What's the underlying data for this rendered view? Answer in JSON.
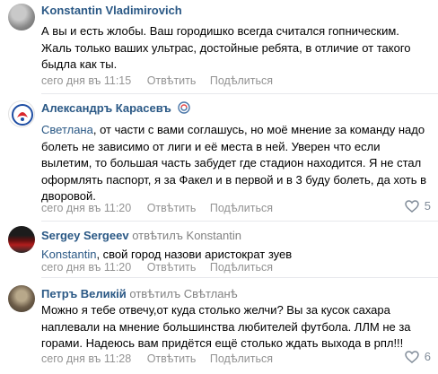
{
  "comments": [
    {
      "author": "Konstantin Vladimirovich",
      "reply_word": "",
      "reply_target": "",
      "mention": "",
      "lines": [
        "А вы и есть жлобы. Ваш городишко всегда считался гопническим.",
        "Жаль только ваших ультрас, достойные ребята, в отличие от такого",
        "быдла как ты."
      ],
      "date": "сего дня въ 11:15",
      "reply_label": "Отвѣтить",
      "share_label": "Подѣлиться",
      "likes": ""
    },
    {
      "author": "Александръ Карасевъ",
      "reply_word": "",
      "reply_target": "",
      "mention": "Светлана",
      "lines": [
        ", от части с вами соглашусь, но моё мнение за команду надо",
        "болеть не зависимо от лиги и её места в ней. Уверен что если",
        "вылетим, то большая часть забудет где стадион находится. Я не стал",
        "оформлять паспорт, я за Факел и в первой и в 3 буду болеть, да хоть в",
        "дворовой."
      ],
      "date": "сего дня въ 11:20",
      "reply_label": "Отвѣтить",
      "share_label": "Подѣлиться",
      "likes": "5"
    },
    {
      "author": "Sergey Sergeev",
      "reply_word": "отвѣтилъ",
      "reply_target": "Konstantin",
      "mention": "Konstantin",
      "lines": [
        ", свой город назови аристократ зуев"
      ],
      "date": "сего дня въ 11:20",
      "reply_label": "Отвѣтить",
      "share_label": "Подѣлиться",
      "likes": ""
    },
    {
      "author": "Петръ Великій",
      "reply_word": "отвѣтилъ",
      "reply_target": "Свѣтланѣ",
      "mention": "",
      "lines": [
        "Можно я тебе отвечу,от куда столько желчи? Вы за кусок сахара",
        "наплевали на мнение большинства любителей футбола. ЛЛМ не за",
        "горами. Надеюсь вам придётся ещё столько ждать выхода в рпл!!!"
      ],
      "date": "сего дня въ 11:28",
      "reply_label": "Отвѣтить",
      "share_label": "Подѣлиться",
      "likes": "6"
    }
  ],
  "colors": {
    "link": "#2a5885",
    "meta": "#939393",
    "separator": "#e7e8ec"
  },
  "icons": {
    "likes": "heart-icon",
    "verified": "verified-badge-icon"
  }
}
